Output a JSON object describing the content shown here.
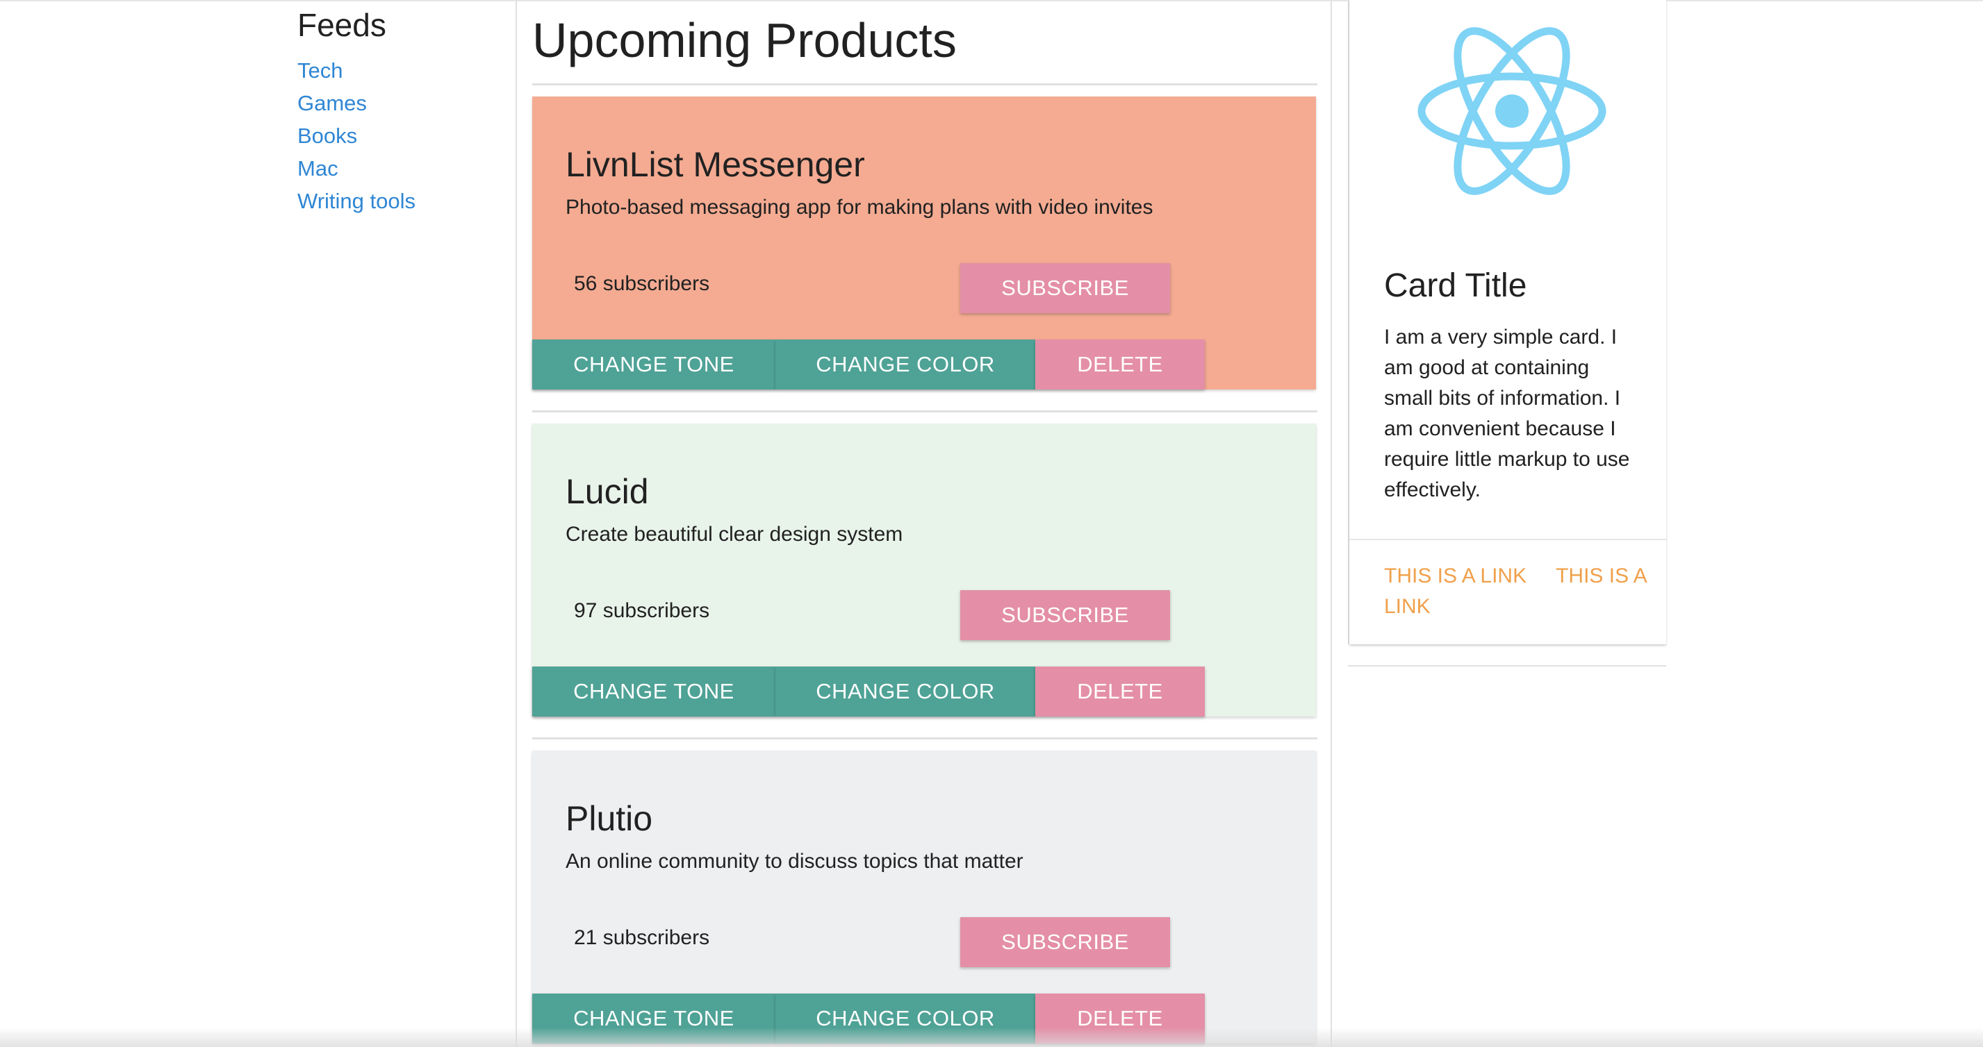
{
  "sidebar": {
    "title": "Feeds",
    "links": [
      "Tech",
      "Games",
      "Books",
      "Mac",
      "Writing tools"
    ]
  },
  "main": {
    "title": "Upcoming Products",
    "products": [
      {
        "name": "LivnList Messenger",
        "description": "Photo-based messaging app for making plans with video invites",
        "subscribers": "56 subscribers",
        "background": "#f4ab92",
        "subscribe_label": "SUBSCRIBE",
        "change_tone_label": "CHANGE TONE",
        "change_color_label": "CHANGE COLOR",
        "delete_label": "DELETE"
      },
      {
        "name": "Lucid",
        "description": "Create beautiful clear design system",
        "subscribers": "97 subscribers",
        "background": "#e8f3ea",
        "subscribe_label": "SUBSCRIBE",
        "change_tone_label": "CHANGE TONE",
        "change_color_label": "CHANGE COLOR",
        "delete_label": "DELETE"
      },
      {
        "name": "Plutio",
        "description": "An online community to discuss topics that matter",
        "subscribers": "21 subscribers",
        "background": "#eeeff1",
        "subscribe_label": "SUBSCRIBE",
        "change_tone_label": "CHANGE TONE",
        "change_color_label": "CHANGE COLOR",
        "delete_label": "DELETE"
      }
    ]
  },
  "info_card": {
    "logo_icon": "react-logo-icon",
    "title": "Card Title",
    "body": "I am a very simple card. I am good at containing small bits of information. I am convenient because I require little markup to use effectively.",
    "links": [
      "This is a link",
      "This is a link"
    ]
  },
  "colors": {
    "teal_button": "#4fa296",
    "pink_button": "#e48fa7",
    "link_blue": "#2f86d4",
    "link_orange": "#f0a04b",
    "react_blue": "#7fd3f5"
  }
}
